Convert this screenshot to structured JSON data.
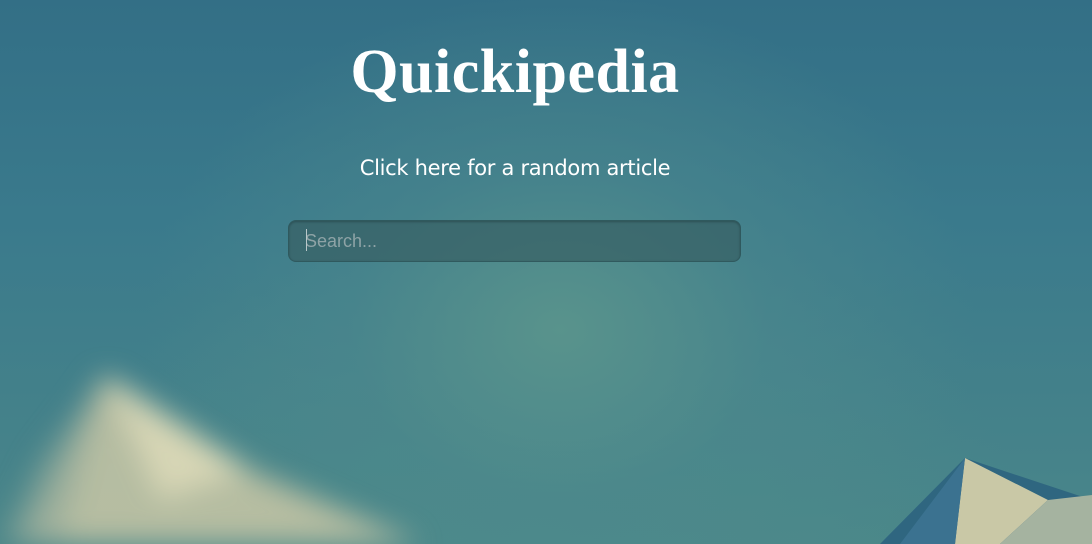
{
  "page": {
    "title": "Quickipedia",
    "random_link": "Click here for a random article"
  },
  "search": {
    "placeholder": "Search...",
    "value": ""
  },
  "colors": {
    "background_top": "#336f86",
    "background_center": "#5a948c",
    "text": "#ffffff",
    "input_bg": "#375f64",
    "mountain_light": "#d8d4b0",
    "mountain_dark": "#2f6680"
  }
}
